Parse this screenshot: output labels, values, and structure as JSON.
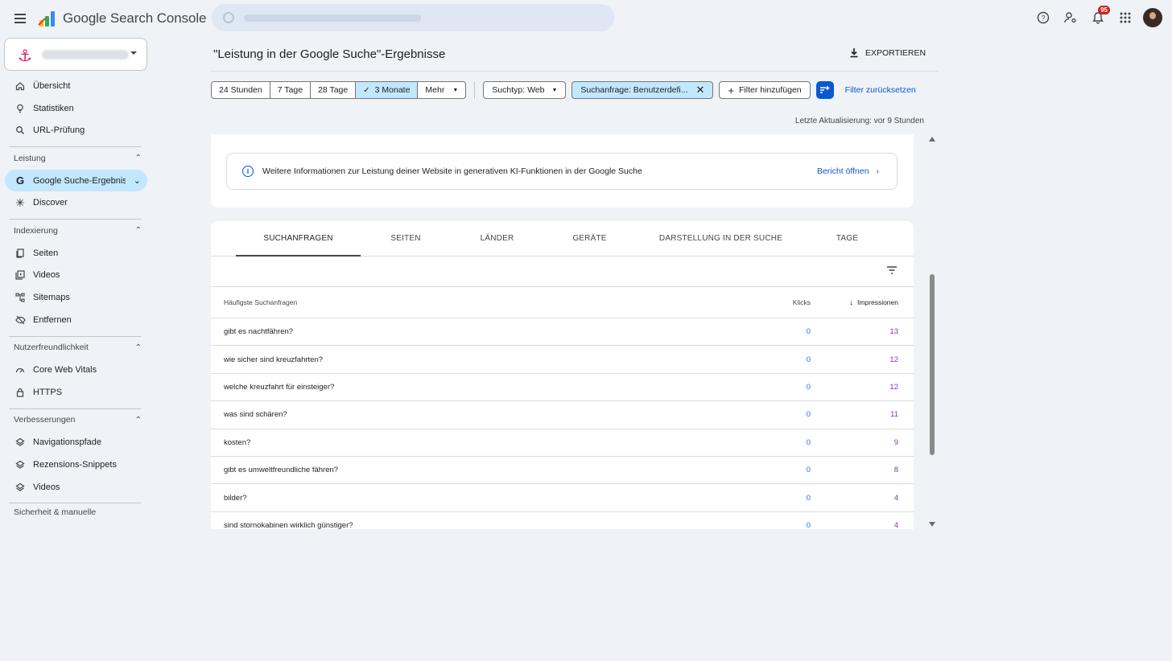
{
  "app": {
    "title": "Google Search Console",
    "notifications_count": "95"
  },
  "sidebar": {
    "top_items": [
      {
        "label": "Übersicht",
        "icon": "home-icon"
      },
      {
        "label": "Statistiken",
        "icon": "lightbulb-icon"
      },
      {
        "label": "URL-Prüfung",
        "icon": "search-icon"
      }
    ],
    "sections": [
      {
        "title": "Leistung",
        "items": [
          {
            "label": "Google Suche-Ergebnisse",
            "icon": "google-g-icon",
            "active": true
          },
          {
            "label": "Discover",
            "icon": "asterisk-icon"
          }
        ]
      },
      {
        "title": "Indexierung",
        "items": [
          {
            "label": "Seiten",
            "icon": "pages-icon"
          },
          {
            "label": "Videos",
            "icon": "video-icon"
          },
          {
            "label": "Sitemaps",
            "icon": "sitemap-icon"
          },
          {
            "label": "Entfernen",
            "icon": "eye-off-icon"
          }
        ]
      },
      {
        "title": "Nutzerfreundlichkeit",
        "items": [
          {
            "label": "Core Web Vitals",
            "icon": "gauge-icon"
          },
          {
            "label": "HTTPS",
            "icon": "lock-icon"
          }
        ]
      },
      {
        "title": "Verbesserungen",
        "items": [
          {
            "label": "Navigationspfade",
            "icon": "layers-icon"
          },
          {
            "label": "Rezensions-Snippets",
            "icon": "layers-icon"
          },
          {
            "label": "Videos",
            "icon": "layers-icon"
          }
        ]
      }
    ],
    "last_section_title": "Sicherheit & manuelle"
  },
  "header": {
    "title": "\"Leistung in der Google Suche\"-Ergebnisse",
    "export_label": "EXPORTIEREN"
  },
  "filters": {
    "date_ranges": [
      "24 Stunden",
      "7 Tage",
      "28 Tage",
      "3 Monate"
    ],
    "date_more": "Mehr",
    "search_type": "Suchtyp: Web",
    "query_filter": "Suchanfrage: Benutzerdefi...",
    "add_filter": "Filter hinzufügen",
    "reset": "Filter zurücksetzen",
    "last_updated": "Letzte Aktualisierung: vor 9 Stunden"
  },
  "info_banner": {
    "text": "Weitere Informationen zur Leistung deiner Website in generativen KI-Funktionen in der Google Suche",
    "link": "Bericht öffnen"
  },
  "tabs": [
    "SUCHANFRAGEN",
    "SEITEN",
    "LÄNDER",
    "GERÄTE",
    "DARSTELLUNG IN DER SUCHE",
    "TAGE"
  ],
  "table": {
    "headers": {
      "query": "Häufigste Suchanfragen",
      "clicks": "Klicks",
      "impressions": "Impressionen"
    },
    "rows": [
      {
        "query": "gibt es nachtfähren?",
        "clicks": "0",
        "impressions": "13"
      },
      {
        "query": "wie sicher sind kreuzfahrten?",
        "clicks": "0",
        "impressions": "12"
      },
      {
        "query": "welche kreuzfahrt für einsteiger?",
        "clicks": "0",
        "impressions": "12"
      },
      {
        "query": "was sind schären?",
        "clicks": "0",
        "impressions": "11"
      },
      {
        "query": "kosten?",
        "clicks": "0",
        "impressions": "9"
      },
      {
        "query": "gibt es umweltfreundliche fähren?",
        "clicks": "0",
        "impressions": "8"
      },
      {
        "query": "bilder?",
        "clicks": "0",
        "impressions": "4"
      },
      {
        "query": "sind stornokabinen wirklich günstiger?",
        "clicks": "0",
        "impressions": "4"
      }
    ]
  }
}
